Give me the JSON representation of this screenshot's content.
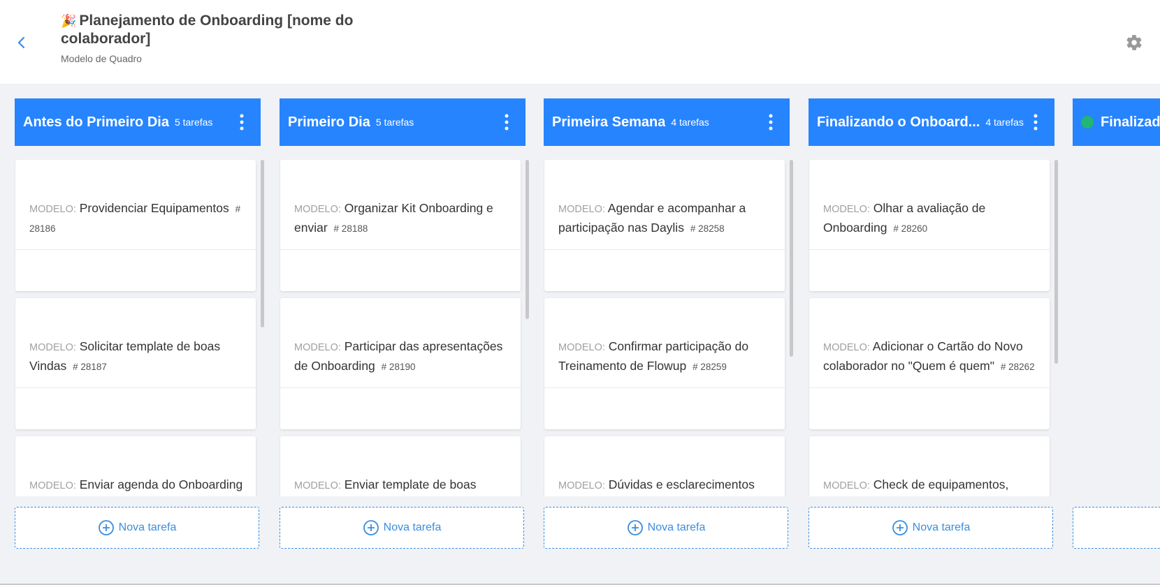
{
  "header": {
    "emoji": "🎉",
    "title": "Planejamento de Onboarding [nome do colaborador]",
    "subtitle": "Modelo de Quadro"
  },
  "icons": {
    "back": "chevron-left-icon",
    "settings": "gear-icon",
    "column_menu": "vertical-dots-icon",
    "add": "plus-circle-icon"
  },
  "colors": {
    "column_header": "#2684ff",
    "accent": "#3b8de0",
    "done_dot": "#22b573"
  },
  "columns": [
    {
      "title": "Antes do Primeiro Dia",
      "count": "5 tarefas",
      "new_task": "Nova tarefa",
      "cards": [
        {
          "prefix": "MODELO:",
          "text": "Providenciar Equipamentos",
          "code": "# 28186"
        },
        {
          "prefix": "MODELO:",
          "text": "Solicitar template de boas Vindas",
          "code": "# 28187"
        },
        {
          "prefix": "MODELO:",
          "text": "Enviar agenda do Onboarding",
          "code": ""
        }
      ]
    },
    {
      "title": "Primeiro Dia",
      "count": "5 tarefas",
      "new_task": "Nova tarefa",
      "cards": [
        {
          "prefix": "MODELO:",
          "text": "Organizar Kit Onboarding e enviar",
          "code": "# 28188"
        },
        {
          "prefix": "MODELO:",
          "text": "Participar das apresentações de Onboarding",
          "code": "# 28190"
        },
        {
          "prefix": "MODELO:",
          "text": "Enviar template de boas",
          "code": ""
        }
      ]
    },
    {
      "title": "Primeira Semana",
      "count": "4 tarefas",
      "new_task": "Nova tarefa",
      "cards": [
        {
          "prefix": "MODELO:",
          "text": "Agendar e acompanhar a participação nas Daylis",
          "code": "# 28258"
        },
        {
          "prefix": "MODELO:",
          "text": "Confirmar participação do Treinamento de Flowup",
          "code": "# 28259"
        },
        {
          "prefix": "MODELO:",
          "text": "Dúvidas e esclarecimentos",
          "code": ""
        }
      ]
    },
    {
      "title": "Finalizando o Onboard...",
      "count": "4 tarefas",
      "new_task": "Nova tarefa",
      "cards": [
        {
          "prefix": "MODELO:",
          "text": "Olhar a avaliação de Onboarding",
          "code": "# 28260"
        },
        {
          "prefix": "MODELO:",
          "text": "Adicionar o Cartão do Novo colaborador no \"Quem é quem\"",
          "code": "# 28262"
        },
        {
          "prefix": "MODELO:",
          "text": "Check de equipamentos,",
          "code": ""
        }
      ]
    },
    {
      "title": "Finalizad",
      "count": "",
      "new_task": "",
      "cards": []
    }
  ]
}
